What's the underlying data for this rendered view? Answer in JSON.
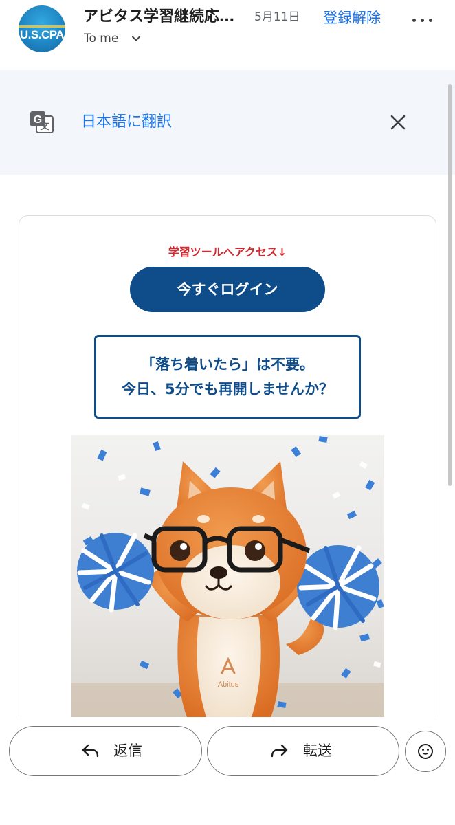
{
  "header": {
    "avatar_text": "U.S.CPA",
    "subject": "アビタス学習継続応援メール",
    "date": "5月11日",
    "unsubscribe": "登録解除",
    "recipient": "To me",
    "more_icon": "more-vert-icon",
    "expand_icon": "chevron-down-icon"
  },
  "translate_bar": {
    "icon": "google-translate-icon",
    "link": "日本語に翻訳",
    "close_icon": "close-icon"
  },
  "email": {
    "access_text": "学習ツールへアクセス↓",
    "login_button": "今すぐログイン",
    "message_line1": "「落ち着いたら」は不要。",
    "message_line2": "今日、5分でも再開しませんか？",
    "image_logo_text": "Abitus",
    "colors": {
      "accent_navy": "#0f4c8a",
      "accent_red": "#d2282e",
      "link_blue": "#1a73e8"
    }
  },
  "actions": {
    "reply": "返信",
    "forward": "転送",
    "reply_icon": "reply-icon",
    "forward_icon": "forward-icon",
    "emoji_icon": "emoji-icon"
  }
}
